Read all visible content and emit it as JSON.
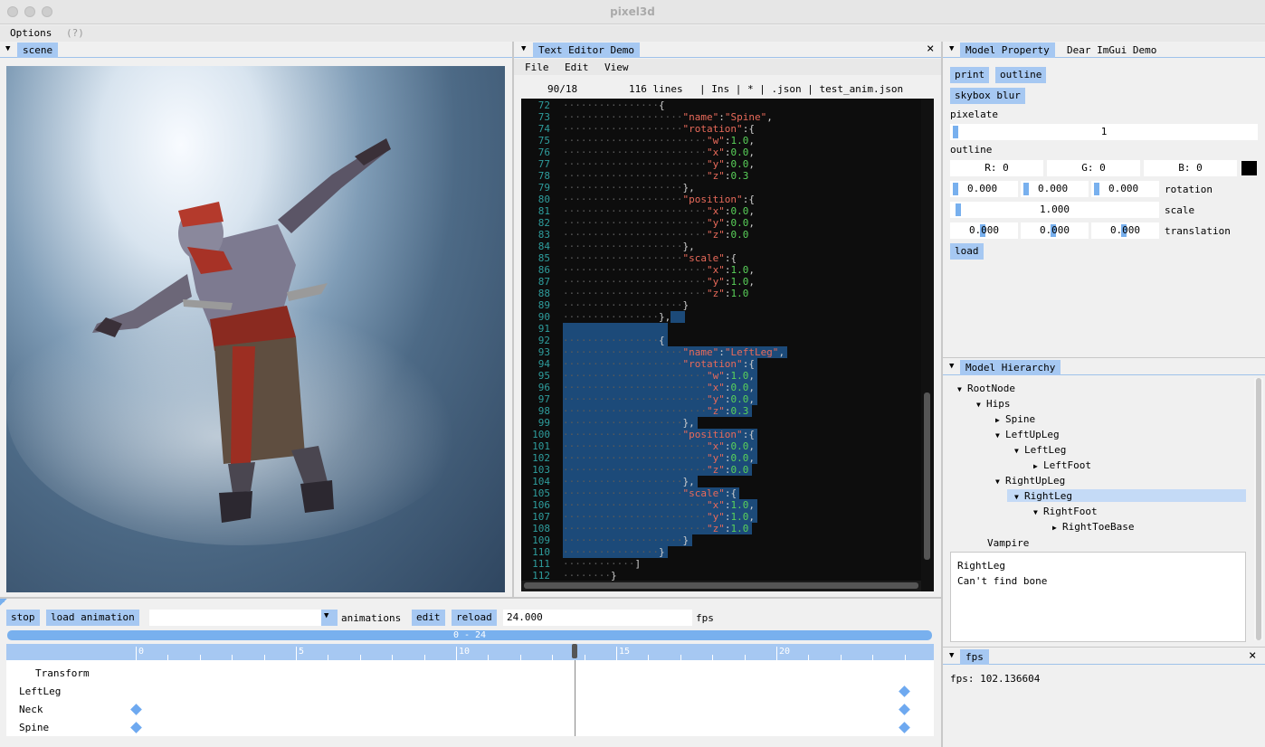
{
  "window": {
    "title": "pixel3d"
  },
  "menubar": {
    "options": "Options",
    "help": "(?)"
  },
  "scene_panel": {
    "tab": "scene"
  },
  "editor_panel": {
    "tab": "Text Editor Demo",
    "menu": [
      "File",
      "Edit",
      "View"
    ],
    "status": {
      "cursor": "90/18",
      "lines": "116 lines",
      "rest": "| Ins | * | .json | test_anim.json"
    },
    "lines": [
      {
        "no": "72",
        "ind": 16,
        "tokens": [
          [
            "p",
            "{"
          ]
        ]
      },
      {
        "no": "73",
        "ind": 20,
        "tokens": [
          [
            "k",
            "\"name\""
          ],
          [
            "p",
            ":"
          ],
          [
            "k",
            "\"Spine\""
          ],
          [
            "p",
            ","
          ]
        ]
      },
      {
        "no": "74",
        "ind": 20,
        "tokens": [
          [
            "k",
            "\"rotation\""
          ],
          [
            "p",
            ":"
          ],
          [
            "p",
            "{"
          ]
        ]
      },
      {
        "no": "75",
        "ind": 24,
        "tokens": [
          [
            "k",
            "\"w\""
          ],
          [
            "p",
            ":"
          ],
          [
            "n",
            "1.0"
          ],
          [
            "p",
            ","
          ]
        ]
      },
      {
        "no": "76",
        "ind": 24,
        "tokens": [
          [
            "k",
            "\"x\""
          ],
          [
            "p",
            ":"
          ],
          [
            "n",
            "0.0"
          ],
          [
            "p",
            ","
          ]
        ]
      },
      {
        "no": "77",
        "ind": 24,
        "tokens": [
          [
            "k",
            "\"y\""
          ],
          [
            "p",
            ":"
          ],
          [
            "n",
            "0.0"
          ],
          [
            "p",
            ","
          ]
        ]
      },
      {
        "no": "78",
        "ind": 24,
        "tokens": [
          [
            "k",
            "\"z\""
          ],
          [
            "p",
            ":"
          ],
          [
            "n",
            "0.3"
          ]
        ]
      },
      {
        "no": "79",
        "ind": 20,
        "tokens": [
          [
            "p",
            "},"
          ]
        ]
      },
      {
        "no": "80",
        "ind": 20,
        "tokens": [
          [
            "k",
            "\"position\""
          ],
          [
            "p",
            ":"
          ],
          [
            "p",
            "{"
          ]
        ]
      },
      {
        "no": "81",
        "ind": 24,
        "tokens": [
          [
            "k",
            "\"x\""
          ],
          [
            "p",
            ":"
          ],
          [
            "n",
            "0.0"
          ],
          [
            "p",
            ","
          ]
        ]
      },
      {
        "no": "82",
        "ind": 24,
        "tokens": [
          [
            "k",
            "\"y\""
          ],
          [
            "p",
            ":"
          ],
          [
            "n",
            "0.0"
          ],
          [
            "p",
            ","
          ]
        ]
      },
      {
        "no": "83",
        "ind": 24,
        "tokens": [
          [
            "k",
            "\"z\""
          ],
          [
            "p",
            ":"
          ],
          [
            "n",
            "0.0"
          ]
        ]
      },
      {
        "no": "84",
        "ind": 20,
        "tokens": [
          [
            "p",
            "},"
          ]
        ]
      },
      {
        "no": "85",
        "ind": 20,
        "tokens": [
          [
            "k",
            "\"scale\""
          ],
          [
            "p",
            ":"
          ],
          [
            "p",
            "{"
          ]
        ]
      },
      {
        "no": "86",
        "ind": 24,
        "tokens": [
          [
            "k",
            "\"x\""
          ],
          [
            "p",
            ":"
          ],
          [
            "n",
            "1.0"
          ],
          [
            "p",
            ","
          ]
        ]
      },
      {
        "no": "87",
        "ind": 24,
        "tokens": [
          [
            "k",
            "\"y\""
          ],
          [
            "p",
            ":"
          ],
          [
            "n",
            "1.0"
          ],
          [
            "p",
            ","
          ]
        ]
      },
      {
        "no": "88",
        "ind": 24,
        "tokens": [
          [
            "k",
            "\"z\""
          ],
          [
            "p",
            ":"
          ],
          [
            "n",
            "1.0"
          ]
        ]
      },
      {
        "no": "89",
        "ind": 20,
        "tokens": [
          [
            "p",
            "}"
          ]
        ]
      },
      {
        "no": "90",
        "ind": 16,
        "tokens": [
          [
            "p",
            "},"
          ]
        ]
      },
      {
        "no": "91",
        "ind": 0,
        "tokens": []
      },
      {
        "no": "92",
        "ind": 16,
        "tokens": [
          [
            "p",
            "{"
          ]
        ]
      },
      {
        "no": "93",
        "ind": 20,
        "tokens": [
          [
            "k",
            "\"name\""
          ],
          [
            "p",
            ":"
          ],
          [
            "k",
            "\"LeftLeg\""
          ],
          [
            "p",
            ","
          ]
        ]
      },
      {
        "no": "94",
        "ind": 20,
        "tokens": [
          [
            "k",
            "\"rotation\""
          ],
          [
            "p",
            ":"
          ],
          [
            "p",
            "{"
          ]
        ]
      },
      {
        "no": "95",
        "ind": 24,
        "tokens": [
          [
            "k",
            "\"w\""
          ],
          [
            "p",
            ":"
          ],
          [
            "n",
            "1.0"
          ],
          [
            "p",
            ","
          ]
        ]
      },
      {
        "no": "96",
        "ind": 24,
        "tokens": [
          [
            "k",
            "\"x\""
          ],
          [
            "p",
            ":"
          ],
          [
            "n",
            "0.0"
          ],
          [
            "p",
            ","
          ]
        ]
      },
      {
        "no": "97",
        "ind": 24,
        "tokens": [
          [
            "k",
            "\"y\""
          ],
          [
            "p",
            ":"
          ],
          [
            "n",
            "0.0"
          ],
          [
            "p",
            ","
          ]
        ]
      },
      {
        "no": "98",
        "ind": 24,
        "tokens": [
          [
            "k",
            "\"z\""
          ],
          [
            "p",
            ":"
          ],
          [
            "n",
            "0.3"
          ]
        ]
      },
      {
        "no": "99",
        "ind": 20,
        "tokens": [
          [
            "p",
            "},"
          ]
        ]
      },
      {
        "no": "100",
        "ind": 20,
        "tokens": [
          [
            "k",
            "\"position\""
          ],
          [
            "p",
            ":"
          ],
          [
            "p",
            "{"
          ]
        ]
      },
      {
        "no": "101",
        "ind": 24,
        "tokens": [
          [
            "k",
            "\"x\""
          ],
          [
            "p",
            ":"
          ],
          [
            "n",
            "0.0"
          ],
          [
            "p",
            ","
          ]
        ]
      },
      {
        "no": "102",
        "ind": 24,
        "tokens": [
          [
            "k",
            "\"y\""
          ],
          [
            "p",
            ":"
          ],
          [
            "n",
            "0.0"
          ],
          [
            "p",
            ","
          ]
        ]
      },
      {
        "no": "103",
        "ind": 24,
        "tokens": [
          [
            "k",
            "\"z\""
          ],
          [
            "p",
            ":"
          ],
          [
            "n",
            "0.0"
          ]
        ]
      },
      {
        "no": "104",
        "ind": 20,
        "tokens": [
          [
            "p",
            "},"
          ]
        ]
      },
      {
        "no": "105",
        "ind": 20,
        "tokens": [
          [
            "k",
            "\"scale\""
          ],
          [
            "p",
            ":"
          ],
          [
            "p",
            "{"
          ]
        ]
      },
      {
        "no": "106",
        "ind": 24,
        "tokens": [
          [
            "k",
            "\"x\""
          ],
          [
            "p",
            ":"
          ],
          [
            "n",
            "1.0"
          ],
          [
            "p",
            ","
          ]
        ]
      },
      {
        "no": "107",
        "ind": 24,
        "tokens": [
          [
            "k",
            "\"y\""
          ],
          [
            "p",
            ":"
          ],
          [
            "n",
            "1.0"
          ],
          [
            "p",
            ","
          ]
        ]
      },
      {
        "no": "108",
        "ind": 24,
        "tokens": [
          [
            "k",
            "\"z\""
          ],
          [
            "p",
            ":"
          ],
          [
            "n",
            "1.0"
          ]
        ]
      },
      {
        "no": "109",
        "ind": 20,
        "tokens": [
          [
            "p",
            "}"
          ]
        ]
      },
      {
        "no": "110",
        "ind": 16,
        "tokens": [
          [
            "p",
            "}"
          ]
        ]
      },
      {
        "no": "111",
        "ind": 12,
        "tokens": [
          [
            "p",
            "]"
          ]
        ]
      },
      {
        "no": "112",
        "ind": 8,
        "tokens": [
          [
            "p",
            "}"
          ]
        ]
      }
    ]
  },
  "model_property": {
    "tab": "Model Property",
    "tab2": "Dear ImGui Demo",
    "print": "print",
    "outline_btn": "outline",
    "skybox_blur": "skybox blur",
    "pixelate_label": "pixelate",
    "pixelate_value": "1",
    "outline_label": "outline",
    "r": "R:  0",
    "g": "G:  0",
    "b": "B:  0",
    "rotation": [
      "0.000",
      "0.000",
      "0.000"
    ],
    "rotation_label": "rotation",
    "scale": "1.000",
    "scale_label": "scale",
    "translation": [
      "0.000",
      "0.000",
      "0.000"
    ],
    "translation_label": "translation",
    "load": "load"
  },
  "model_hierarchy": {
    "tab": "Model Hierarchy",
    "nodes": [
      {
        "label": "RootNode",
        "level": 0,
        "tri": "▼"
      },
      {
        "label": "Hips",
        "level": 1,
        "tri": "▼"
      },
      {
        "label": "Spine",
        "level": 2,
        "tri": "▶"
      },
      {
        "label": "LeftUpLeg",
        "level": 2,
        "tri": "▼"
      },
      {
        "label": "LeftLeg",
        "level": 3,
        "tri": "▼"
      },
      {
        "label": "LeftFoot",
        "level": 4,
        "tri": "▶"
      },
      {
        "label": "RightUpLeg",
        "level": 2,
        "tri": "▼"
      },
      {
        "label": "RightLeg",
        "level": 3,
        "tri": "▼",
        "selected": true
      },
      {
        "label": "RightFoot",
        "level": 4,
        "tri": "▼"
      },
      {
        "label": "RightToeBase",
        "level": 5,
        "tri": "▶"
      }
    ],
    "model_name": "Vampire",
    "info_line1": "RightLeg",
    "info_line2": "Can't find bone"
  },
  "fps_panel": {
    "tab": "fps",
    "text": "fps: 102.136604"
  },
  "animation": {
    "stop": "stop",
    "load_animation": "load animation",
    "animations_label": "animations",
    "edit": "edit",
    "reload": "reload",
    "fps_value": "24.000",
    "fps_label": "fps",
    "range": "0 - 24",
    "ticks": [
      "0",
      "5",
      "10",
      "15",
      "20"
    ],
    "playhead_frame": 13.7,
    "tracks": [
      {
        "label": "Transform",
        "keys": []
      },
      {
        "label": "LeftLeg",
        "keys": [
          24
        ]
      },
      {
        "label": "Neck",
        "keys": [
          0,
          24
        ]
      },
      {
        "label": "Spine",
        "keys": [
          0,
          24
        ]
      }
    ]
  },
  "colors": {
    "accent": "#a6c8f2",
    "selection": "#1c4a79",
    "keyword": "#e86a5a",
    "number": "#5ad25a"
  }
}
